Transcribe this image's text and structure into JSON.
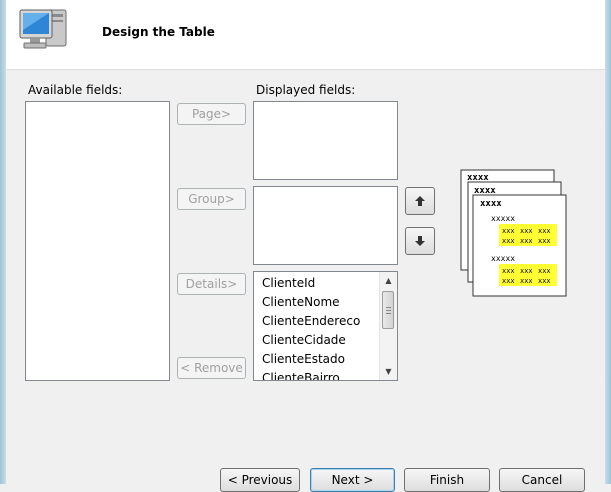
{
  "header": {
    "title": "Design the Table"
  },
  "available_fields": {
    "label": "Available fields:",
    "items": []
  },
  "displayed_fields": {
    "label": "Displayed fields:",
    "page_items": [],
    "group_items": [],
    "detail_items": [
      "ClienteId",
      "ClienteNome",
      "ClienteEndereco",
      "ClienteCidade",
      "ClienteEstado",
      "ClienteBairro"
    ]
  },
  "buttons": {
    "page": "Page>",
    "group": "Group>",
    "details": "Details>",
    "remove": "< Remove",
    "move_up": "↑",
    "move_down": "↓",
    "previous": "< Previous",
    "next": "Next >",
    "finish": "Finish",
    "cancel": "Cancel"
  },
  "preview": {
    "page_marker": "xxxx",
    "group_marker": "xxxx",
    "detail_marker": "xxxx",
    "sub_marker": "xxxxx",
    "cell": "xxx",
    "highlight_color": "#ffff33"
  },
  "icons": {
    "wizard": "computer-monitor-icon"
  }
}
